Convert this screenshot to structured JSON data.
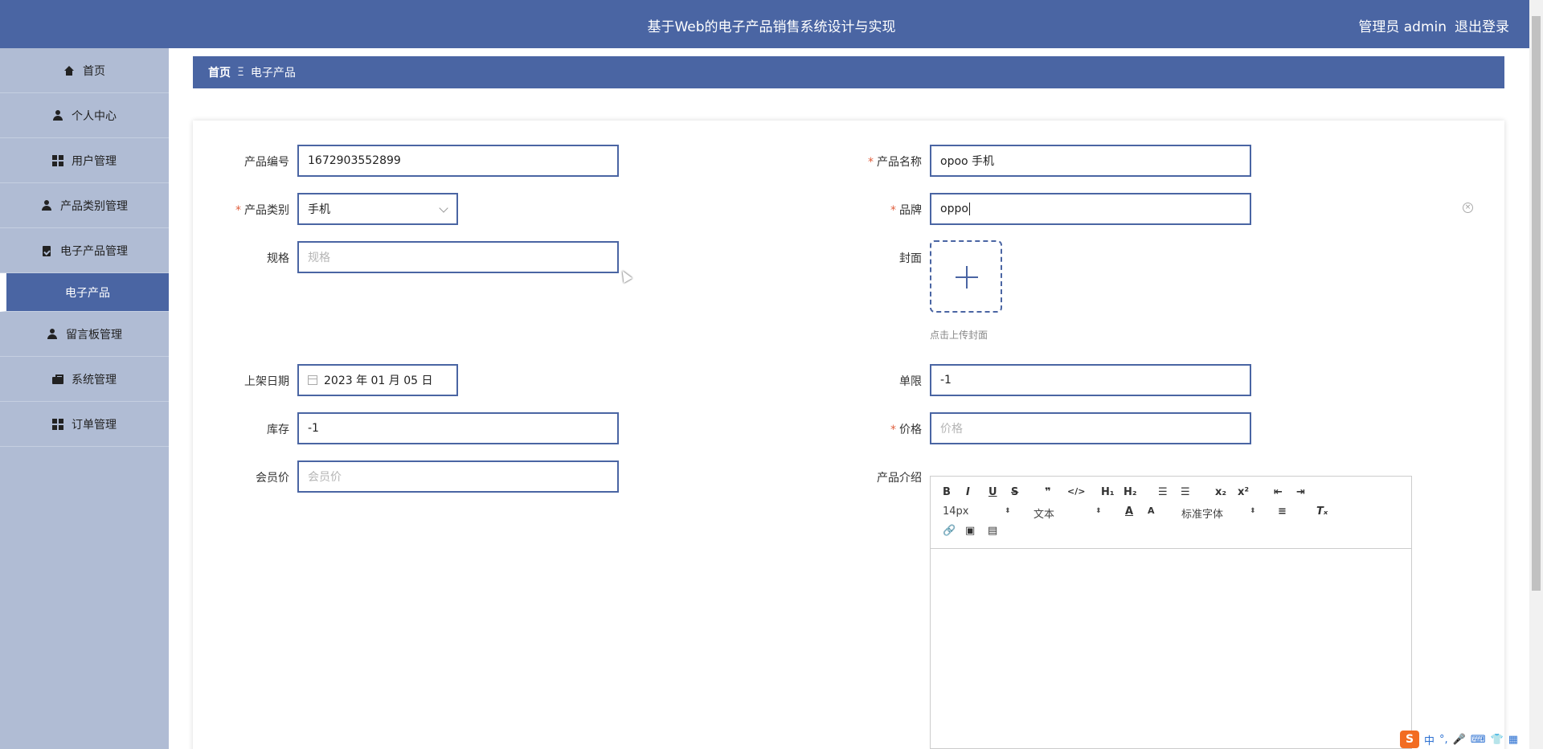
{
  "header": {
    "title": "基于Web的电子产品销售系统设计与实现",
    "user_label": "管理员 admin",
    "logout_label": "退出登录"
  },
  "sidebar": {
    "items": [
      {
        "label": "首页",
        "icon": "home-icon"
      },
      {
        "label": "个人中心",
        "icon": "user-icon"
      },
      {
        "label": "用户管理",
        "icon": "grid-icon"
      },
      {
        "label": "产品类别管理",
        "icon": "user-icon"
      },
      {
        "label": "电子产品管理",
        "icon": "clipboard-icon"
      },
      {
        "label": "电子产品",
        "icon": ""
      },
      {
        "label": "留言板管理",
        "icon": "user-icon"
      },
      {
        "label": "系统管理",
        "icon": "briefcase-icon"
      },
      {
        "label": "订单管理",
        "icon": "grid-icon"
      }
    ]
  },
  "breadcrumb": {
    "home": "首页",
    "separator": "Ξ",
    "current": "电子产品"
  },
  "form": {
    "product_code": {
      "label": "产品编号",
      "value": "1672903552899"
    },
    "product_name": {
      "label": "产品名称",
      "value": "opoo 手机"
    },
    "category": {
      "label": "产品类别",
      "value": "手机"
    },
    "brand": {
      "label": "品牌",
      "value": "oppo"
    },
    "spec": {
      "label": "规格",
      "placeholder": "规格"
    },
    "cover": {
      "label": "封面",
      "hint": "点击上传封面"
    },
    "list_date": {
      "label": "上架日期",
      "value": "2023 年 01 月 05 日"
    },
    "limit": {
      "label": "单限",
      "value": "-1"
    },
    "stock": {
      "label": "库存",
      "value": "-1"
    },
    "price": {
      "label": "价格",
      "placeholder": "价格"
    },
    "member_price": {
      "label": "会员价",
      "placeholder": "会员价"
    },
    "intro": {
      "label": "产品介绍"
    },
    "required_mark": "*"
  },
  "editor": {
    "font_size": "14px",
    "text_type": "文本",
    "font_family": "标准字体"
  },
  "ime": {
    "logo": "S",
    "mode": "中"
  },
  "colors": {
    "primary": "#4a65a3",
    "sidebar_bg": "#b0bcd4",
    "required": "#e0603f"
  }
}
